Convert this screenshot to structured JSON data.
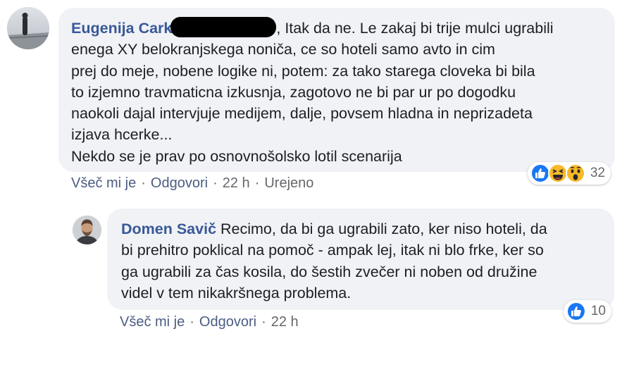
{
  "comments": [
    {
      "author": "Eugenija Cark",
      "text_lines": [
        ", Itak da ne. Le zakaj bi trije mulci ugrabili",
        "enega XY belokranjskega noniča, ce so hoteli samo avto in cim",
        "prej do meje, nobene logike ni, potem: za tako starega cloveka bi bila",
        "to izjemno travmaticna izkusnja, zagotovo ne bi par ur po dogodku",
        "naokoli dajal intervjuje medijem, dalje, povsem hladna in neprizadeta",
        "izjava hcerke...",
        "Nekdo se je prav po osnovnošolsko lotil scenarija"
      ],
      "reactions": {
        "icons": [
          "like-icon",
          "haha-icon",
          "wow-icon"
        ],
        "count": "32"
      },
      "actions": {
        "like": "Všeč mi je",
        "reply": "Odgovori",
        "time": "22 h",
        "edited": "Urejeno"
      }
    },
    {
      "author": "Domen Savič",
      "text_lines": [
        " Recimo, da bi ga ugrabili zato, ker niso hoteli, da",
        "bi prehitro poklical na pomoč - ampak lej, itak ni blo frke, ker so",
        "ga ugrabili za čas kosila, do šestih zvečer ni noben od družine",
        "videl v tem nikakršnega problema."
      ],
      "reactions": {
        "icons": [
          "like-icon"
        ],
        "count": "10"
      },
      "actions": {
        "like": "Všeč mi je",
        "reply": "Odgovori",
        "time": "22 h"
      }
    }
  ],
  "colors": {
    "bubble": "#f0f2f5",
    "author": "#385898",
    "meta": "#65676b",
    "like_blue": "#1877f2",
    "emoji_yellow": "#f7b928"
  }
}
